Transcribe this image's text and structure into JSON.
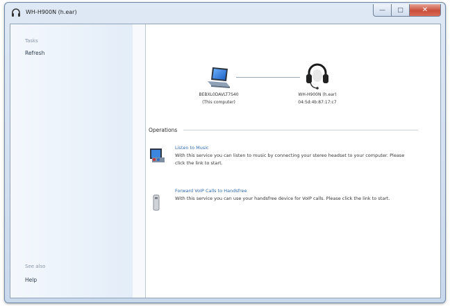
{
  "window": {
    "title": "WH-H900N (h.ear)"
  },
  "sidebar": {
    "tasks_heading": "Tasks",
    "tasks": [
      {
        "label": "Refresh"
      }
    ],
    "see_also_heading": "See also",
    "see_also": [
      {
        "label": "Help"
      }
    ]
  },
  "devices": {
    "computer": {
      "name": "BEBXL0DAVLT7S40",
      "caption": "(This computer)",
      "icon": "laptop-icon"
    },
    "headset": {
      "name": "WH-H900N (h.ear)",
      "address": "04:5d:4b:87:17:c7",
      "icon": "headset-icon"
    }
  },
  "operations": {
    "heading": "Operations",
    "items": [
      {
        "link": "Listen to Music",
        "description": "With this service you can listen to music by connecting your stereo headset to your computer. Please click the link to start.",
        "icon": "music-player-icon"
      },
      {
        "link": "Forward VoIP Calls to Handsfree",
        "description": "With this service you can use your handsfree device for VoIP calls. Please click the link to start.",
        "icon": "handsfree-phone-icon"
      }
    ]
  },
  "colors": {
    "link": "#2e6bb1",
    "close_button": "#c94f3a",
    "sidebar_bg": "#e3edf8"
  }
}
